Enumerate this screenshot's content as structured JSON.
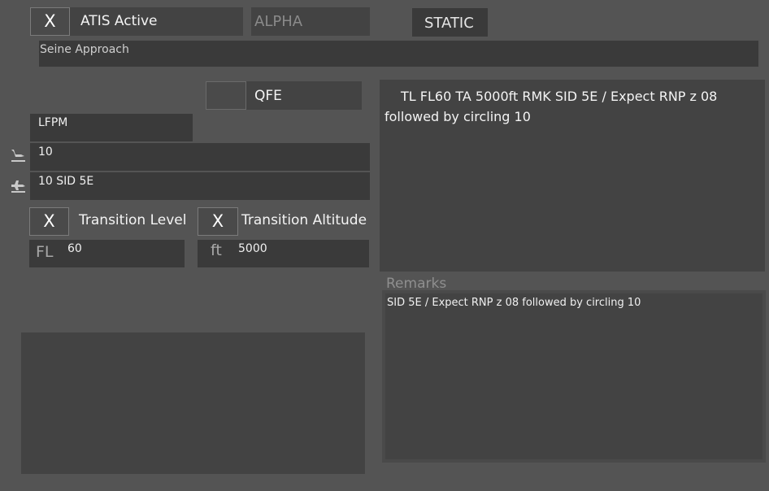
{
  "header": {
    "atis_toggle": "X",
    "atis_label": "ATIS Active",
    "letter": "ALPHA",
    "mode": "STATIC",
    "station_name": "Seine Approach"
  },
  "qfe": {
    "label": "QFE"
  },
  "airport": {
    "icao": "LFPM"
  },
  "runways": {
    "arrival_icon": "arrival-plane-icon",
    "arrival": "10",
    "departure_icon": "departure-plane-icon",
    "departure": "10 SID 5E"
  },
  "transition_level": {
    "toggle": "X",
    "label": "Transition Level",
    "unit": "FL",
    "value": "60"
  },
  "transition_altitude": {
    "toggle": "X",
    "label": "Transition Altitude",
    "unit": "ft",
    "value": "5000"
  },
  "preview": {
    "text": "TL FL60 TA 5000ft RMK SID 5E / Expect RNP z 08 followed by circling 10"
  },
  "remarks": {
    "label": "Remarks",
    "text": "SID 5E / Expect RNP z 08 followed by circling 10"
  }
}
